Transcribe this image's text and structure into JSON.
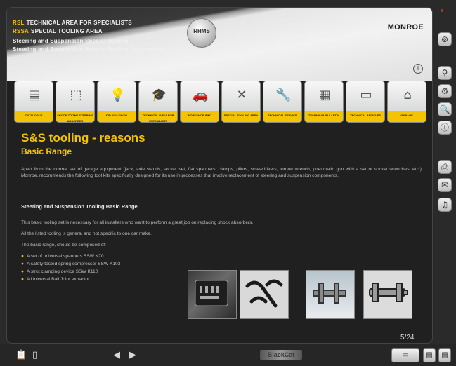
{
  "header": {
    "line1_tag": "RSL",
    "line1": "TECHNICAL AREA FOR SPECIALISTS",
    "line2_tag": "RSSA",
    "line2": "SPECIAL TOOLING AREA",
    "line3": "Steering and Suspension Special Tooling",
    "line4": "Steering and Suspension Special Tooling Assortments",
    "emblem_text": "RHMS",
    "brand": "MONROE"
  },
  "nav": {
    "items": [
      {
        "label": "CATALOGUE",
        "icon": "catalogue-icon",
        "glyph": "▤"
      },
      {
        "label": "SHOCK TO THE STEERING ABSORBER",
        "icon": "shock-absorber-icon",
        "glyph": "⬚"
      },
      {
        "label": "DID YOU KNOW",
        "icon": "lightbulb-icon",
        "glyph": "💡"
      },
      {
        "label": "TECHNICAL AREA FOR SPECIALISTS",
        "icon": "graduation-cap-icon",
        "glyph": "🎓"
      },
      {
        "label": "WORKSHOP INFO",
        "icon": "car-icon",
        "glyph": "🚗"
      },
      {
        "label": "SPECIAL TOOLING AREA",
        "icon": "tools-icon",
        "glyph": "✕"
      },
      {
        "label": "TECHNICAL SERVICE",
        "icon": "wrench-icon",
        "glyph": "🔧"
      },
      {
        "label": "TECHNICAL BULLETIN",
        "icon": "bulletin-icon",
        "glyph": "▦"
      },
      {
        "label": "TECHNICAL ARTICLES",
        "icon": "articles-icon",
        "glyph": "▭"
      },
      {
        "label": "GARAGE",
        "icon": "garage-icon",
        "glyph": "⌂"
      }
    ]
  },
  "content": {
    "title": "S&S tooling - reasons",
    "subtitle": "Basic Range",
    "intro": "Apart from the normal set of garage equipment (jack, axle stands, socket set, flat spanners, clamps, pliers, screwdrivers, torque wrench, pneumatic gun with a set of socket wrenches, etc.) Monroe, recommends the following tool kits specifically designed for its use in processes that involve replacement of steering and suspension components.",
    "section_title": "Steering and Suspension Tooling Basic Range",
    "line1": "This basic tooling set is necessary for all installers who want to perform a great job on replacing shock absorbers.",
    "line2": "All the listed tooling is general and not specific to one car make.",
    "line3": "The basic range, should be composed of:",
    "bullets": [
      "A set of universal spanners SSW K70",
      "A safety tested spring compressor SSW K103",
      "A strut clamping device SSW K110",
      "A Universal Ball Joint extractor"
    ]
  },
  "page_indicator": "5/24",
  "sidebar": {
    "buttons": [
      {
        "icon": "home-icon",
        "glyph": "⊚"
      },
      {
        "icon": "zoom-icon",
        "glyph": "⚲"
      },
      {
        "icon": "settings-icon",
        "glyph": "⚙"
      },
      {
        "icon": "search-icon",
        "glyph": "🔍"
      },
      {
        "icon": "info-icon",
        "glyph": "ⓘ"
      },
      {
        "icon": "print-icon",
        "glyph": "⎙"
      },
      {
        "icon": "message-icon",
        "glyph": "✉"
      },
      {
        "icon": "music-icon",
        "glyph": "♫"
      }
    ]
  },
  "bottom": {
    "prev_glyph": "◀",
    "next_glyph": "▶",
    "logo": "BlackCat"
  },
  "colors": {
    "accent": "#f5c400",
    "background": "#202020"
  }
}
